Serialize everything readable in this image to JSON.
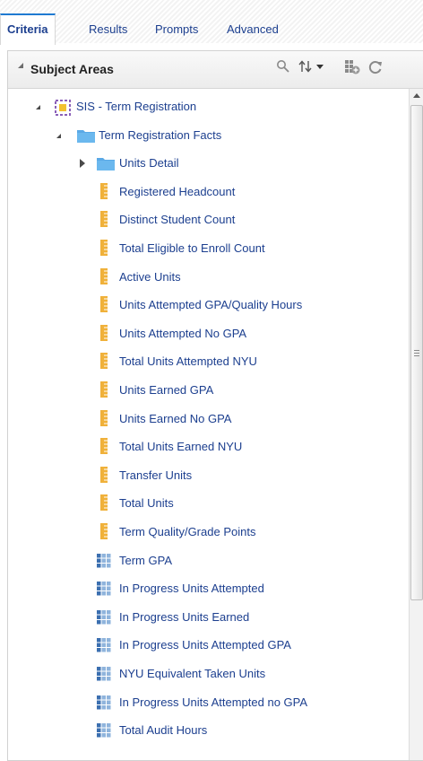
{
  "tabs": [
    {
      "label": "Criteria",
      "active": true
    },
    {
      "label": "Results",
      "active": false
    },
    {
      "label": "Prompts",
      "active": false
    },
    {
      "label": "Advanced",
      "active": false
    }
  ],
  "panel": {
    "title": "Subject Areas",
    "icons": [
      "search-icon",
      "sort-icon",
      "add-subject-area-icon",
      "refresh-icon"
    ]
  },
  "tree": {
    "root": {
      "label": "SIS - Term Registration",
      "icon": "subject-area-icon",
      "expanded": true
    },
    "folders": [
      {
        "label": "Term Registration Facts",
        "expanded": true
      },
      {
        "label": "Units Detail",
        "expanded": false
      }
    ],
    "measures": [
      "Registered Headcount",
      "Distinct Student Count",
      "Total Eligible to Enroll Count",
      "Active Units",
      "Units Attempted GPA/Quality Hours",
      "Units Attempted No GPA",
      "Total Units Attempted NYU",
      "Units Earned GPA",
      "Units Earned No GPA",
      "Total Units Earned NYU",
      "Transfer Units",
      "Total Units",
      "Term Quality/Grade Points"
    ],
    "calculated": [
      "Term GPA",
      "In Progress Units Attempted",
      "In Progress Units Earned",
      "In Progress Units Attempted GPA",
      "NYU Equivalent Taken Units",
      "In Progress Units Attempted no GPA",
      "Total Audit Hours"
    ]
  },
  "colors": {
    "accent": "#1f7ad1",
    "link_text": "#1c3f8f",
    "folder": "#5aa9e6",
    "measure": "#f0b13a",
    "calculated": "#3b6fb0"
  }
}
